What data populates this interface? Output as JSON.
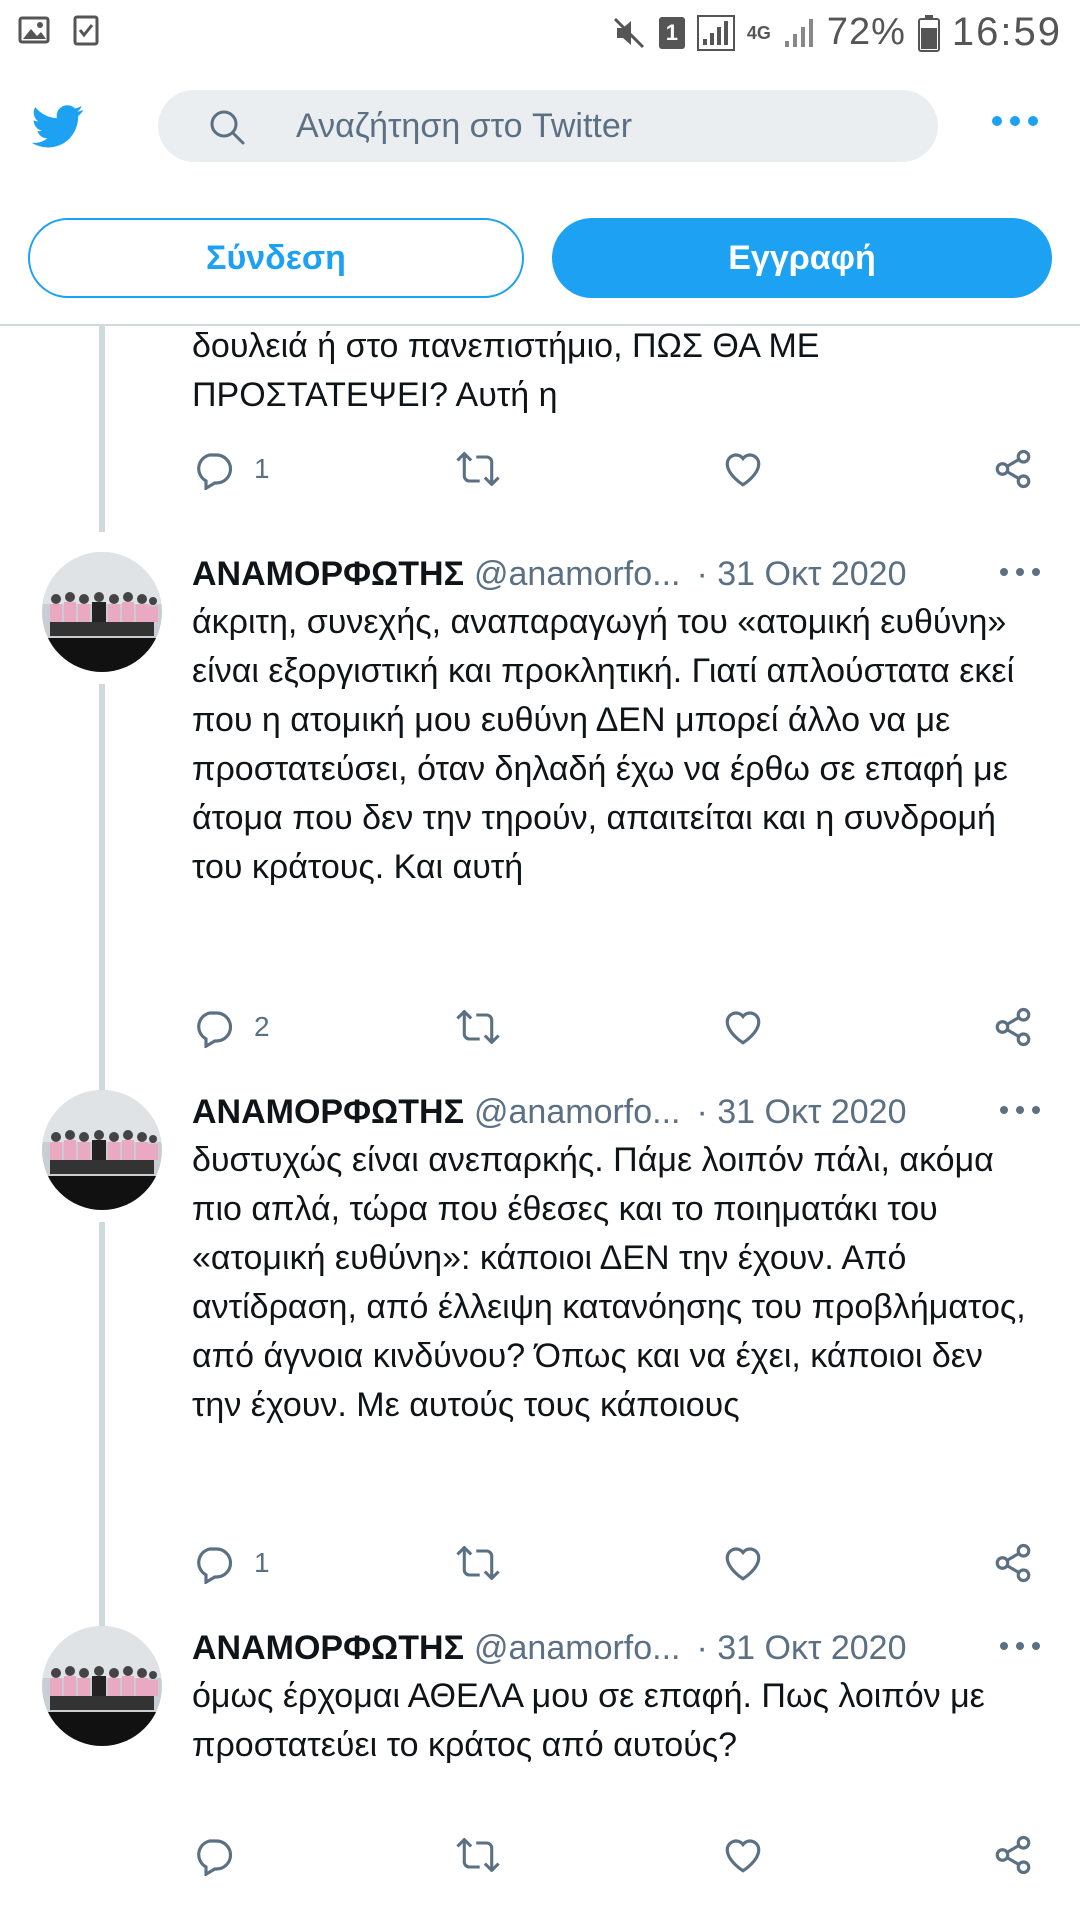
{
  "status_bar": {
    "battery": "72%",
    "time": "16:59",
    "sim_badge": "1",
    "network": "4G"
  },
  "search": {
    "placeholder": "Αναζήτηση στο Twitter"
  },
  "auth": {
    "login_label": "Σύνδεση",
    "signup_label": "Εγγραφή"
  },
  "colors": {
    "accent": "#1da1f2",
    "muted": "#5b7083",
    "divider": "#cfd9de"
  },
  "tweets": [
    {
      "text": "δουλειά ή στο πανεπιστήμιο, ΠΩΣ ΘΑ ΜΕ ΠΡΟΣΤΑΤΕΨΕΙ? Αυτή η",
      "reply_count": "1"
    },
    {
      "name": "ΑΝΑΜΟΡΦΩΤΗΣ",
      "handle": "@anamorfo...",
      "date": "· 31 Οκτ 2020",
      "text": "άκριτη, συνεχής, αναπαραγωγή του «ατομική ευθύνη» είναι εξοργιστική και προκλητική. Γιατί απλούστατα εκεί που η ατομική μου ευθύνη ΔΕΝ μπορεί άλλο να με προστατεύσει, όταν δηλαδή έχω να έρθω σε επαφή με άτομα που δεν την τηρούν, απαιτείται και η συνδρομή του κράτους. Και αυτή",
      "reply_count": "2"
    },
    {
      "name": "ΑΝΑΜΟΡΦΩΤΗΣ",
      "handle": "@anamorfo...",
      "date": "· 31 Οκτ 2020",
      "text": "δυστυχώς είναι ανεπαρκής. Πάμε λοιπόν πάλι, ακόμα πιο απλά, τώρα που έθεσες και το ποιηματάκι του «ατομική ευθύνη»: κάποιοι ΔΕΝ την έχουν. Από αντίδραση, από έλλειψη κατανόησης του προβλήματος, από άγνοια κινδύνου? Όπως και να έχει, κάποιοι δεν την έχουν. Με αυτούς τους κάποιους",
      "reply_count": "1"
    },
    {
      "name": "ΑΝΑΜΟΡΦΩΤΗΣ",
      "handle": "@anamorfo...",
      "date": "· 31 Οκτ 2020",
      "text": "όμως έρχομαι ΑΘΕΛΑ μου σε επαφή. Πως λοιπόν με προστατεύει το κράτος από αυτούς?",
      "reply_count": ""
    }
  ]
}
